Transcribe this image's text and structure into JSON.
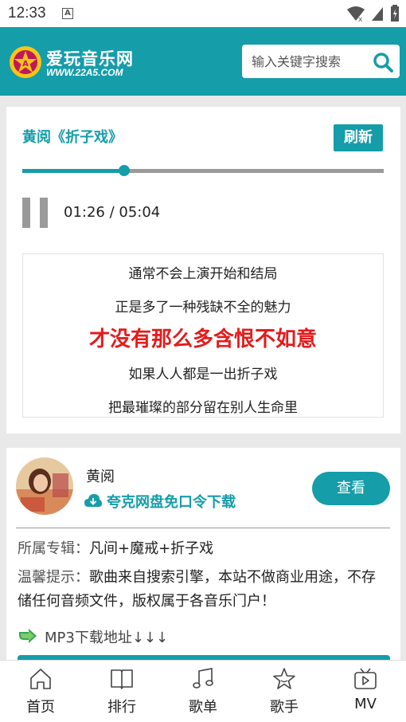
{
  "status_bar": {
    "time": "12:33",
    "notification_icon": "A"
  },
  "header": {
    "logo_title": "爱玩音乐网",
    "logo_url": "WWW.22A5.COM",
    "search_placeholder": "输入关键字搜索"
  },
  "player": {
    "song_title": "黄阅《折子戏》",
    "refresh_label": "刷新",
    "progress": 0.283,
    "current_time": "01:26",
    "time_separator": " / ",
    "total_time": "05:04",
    "lyrics": [
      "通常不会上演开始和结局",
      "正是多了一种残缺不全的魅力",
      "才没有那么多含恨不如意",
      "如果人人都是一出折子戏",
      "把最璀璨的部分留在别人生命里"
    ],
    "active_lyric_index": 2
  },
  "info": {
    "artist": "黄阅",
    "cloud_download_label": "夸克网盘免口令下载",
    "view_label": "查看",
    "album_label": "所属专辑：",
    "album_value": "凡间+魔戒+折子戏",
    "tip_label": "温馨提示：",
    "tip_text": "歌曲来自搜索引擎，本站不做商业用途，不存储任何音频文件，版权属于各音乐门户！",
    "mp3_label": "MP3下载地址↓↓↓"
  },
  "bottom_nav": [
    {
      "label": "首页",
      "icon": "home-icon"
    },
    {
      "label": "排行",
      "icon": "book-icon"
    },
    {
      "label": "歌单",
      "icon": "music-note-icon"
    },
    {
      "label": "歌手",
      "icon": "star-icon"
    },
    {
      "label": "MV",
      "icon": "tv-icon"
    }
  ],
  "colors": {
    "accent": "#159da9",
    "highlight_lyric": "#e41b1b"
  }
}
